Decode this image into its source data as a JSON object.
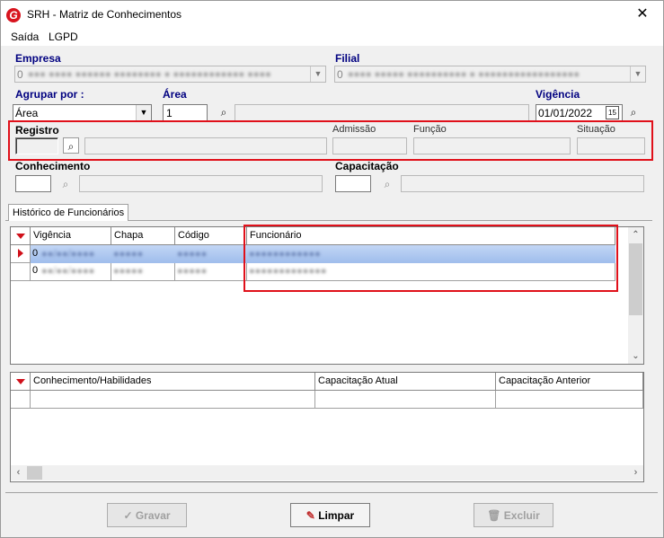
{
  "window": {
    "title": "SRH - Matriz de Conhecimentos",
    "logo_letter": "G",
    "close_glyph": "✕"
  },
  "menu": {
    "items": [
      {
        "label": "Saída"
      },
      {
        "label": "LGPD"
      }
    ]
  },
  "form": {
    "empresa": {
      "label": "Empresa",
      "value": "0"
    },
    "filial": {
      "label": "Filial",
      "value": "0"
    },
    "agrupar": {
      "label": "Agrupar por :",
      "value": "Área"
    },
    "area": {
      "label": "Área",
      "code": "1"
    },
    "vigencia": {
      "label": "Vigência",
      "value": "01/01/2022",
      "calendar_day": "15"
    },
    "registro": {
      "label": "Registro"
    },
    "admissao": {
      "label": "Admissão"
    },
    "funcao": {
      "label": "Função"
    },
    "situacao": {
      "label": "Situação"
    },
    "conhecimento": {
      "label": "Conhecimento"
    },
    "capacitacao": {
      "label": "Capacitação"
    }
  },
  "tabs": [
    {
      "label": "Histórico de Funcionários"
    }
  ],
  "grid1": {
    "columns": [
      "Vigência",
      "Chapa",
      "Código",
      "Funcionário"
    ],
    "rows": [
      {
        "vigencia": "0",
        "selected": true
      },
      {
        "vigencia": "0",
        "selected": false
      }
    ]
  },
  "grid2": {
    "columns": [
      "Conhecimento/Habilidades",
      "Capacitação Atual",
      "Capacitação Anterior"
    ]
  },
  "buttons": {
    "gravar": "Gravar",
    "limpar": "Limpar",
    "excluir": "Excluir"
  },
  "colors": {
    "accent_red": "#e0101a",
    "label_blue": "#000080",
    "selection": "#a8c4ef"
  }
}
